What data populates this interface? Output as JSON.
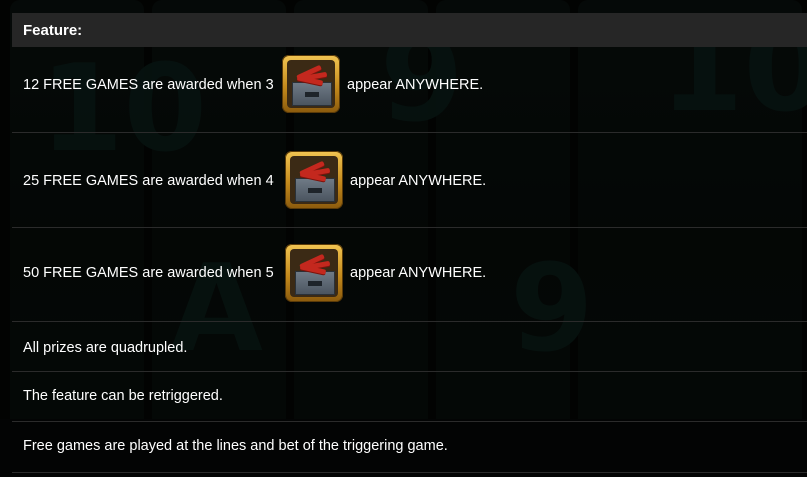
{
  "feature": {
    "title": "Feature:",
    "awards": [
      {
        "prefix": "12 FREE GAMES are awarded when 3",
        "symbol": "dynamite-crate-scatter-icon",
        "suffix": "appear ANYWHERE."
      },
      {
        "prefix": "25 FREE GAMES are awarded when 4",
        "symbol": "dynamite-crate-scatter-icon",
        "suffix": "appear ANYWHERE."
      },
      {
        "prefix": "50 FREE GAMES are awarded when 5",
        "symbol": "dynamite-crate-scatter-icon",
        "suffix": "appear ANYWHERE."
      }
    ],
    "notes": [
      "All prizes are quadrupled.",
      "The feature can be retriggered.",
      "Free games are played at the lines and bet of the triggering game."
    ]
  },
  "colors": {
    "header_bg": "#262626",
    "text": "#ffffff",
    "divider": "#2b2b2b",
    "icon_frame": "#f2c552",
    "dynamite": "#c4281e"
  }
}
